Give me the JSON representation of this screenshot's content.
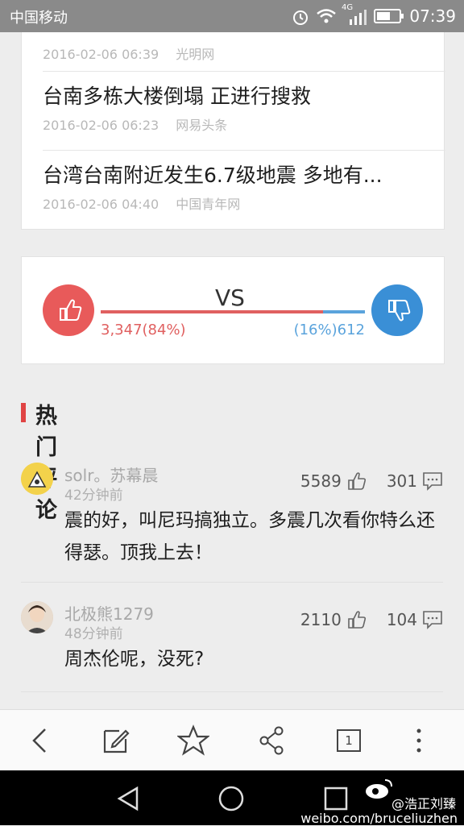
{
  "status_bar": {
    "carrier": "中国移动",
    "network": "4G",
    "time": "07:39"
  },
  "news": [
    {
      "title": "",
      "date": "2016-02-06 06:39",
      "source": "光明网"
    },
    {
      "title": "台南多栋大楼倒塌 正进行搜救",
      "date": "2016-02-06 06:23",
      "source": "网易头条"
    },
    {
      "title": "台湾台南附近发生6.7级地震 多地有...",
      "date": "2016-02-06 04:40",
      "source": "中国青年网"
    }
  ],
  "vote": {
    "vs_label": "VS",
    "like_text": "3,347(84%)",
    "dislike_text": "(16%)612",
    "like_fraction": 0.84,
    "like_color": "#e85a5a",
    "dislike_color": "#3a8fd6"
  },
  "hot_comments": {
    "title": "热门评论",
    "items": [
      {
        "user": "solr。苏幕晨",
        "time": "42分钟前",
        "likes": "5589",
        "replies": "301",
        "text": "震的好，叫尼玛搞独立。多震几次看你特么还得瑟。顶我上去！"
      },
      {
        "user": "北极熊1279",
        "time": "48分钟前",
        "likes": "2110",
        "replies": "104",
        "text": "周杰伦呢，没死?"
      }
    ]
  },
  "toolbar": {
    "page_count": "1"
  },
  "watermark": {
    "handle": "@浩正刘臻",
    "url": "weibo.com/bruceliuzhen"
  }
}
